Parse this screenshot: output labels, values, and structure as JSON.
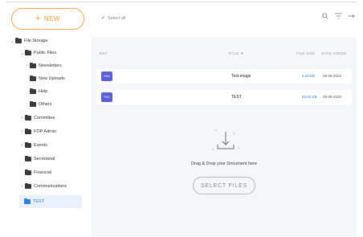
{
  "new_button": {
    "label": "NEW",
    "plus": "+"
  },
  "toolbar": {
    "select_all": "Select all",
    "icons": [
      "search-icon",
      "filter-icon",
      "expand-icon"
    ]
  },
  "sidebar": {
    "items": [
      {
        "label": "File Storage",
        "caret": "⌄"
      },
      {
        "label": "Public Files",
        "caret": "⌄"
      },
      {
        "label": "Newsletters",
        "caret": "›"
      },
      {
        "label": "New Uploads",
        "caret": ""
      },
      {
        "label": "Help",
        "caret": ""
      },
      {
        "label": "Others",
        "caret": ""
      },
      {
        "label": "Committee",
        "caret": "›"
      },
      {
        "label": "FOP Admin",
        "caret": "›"
      },
      {
        "label": "Events",
        "caret": "›"
      },
      {
        "label": "Secretarial",
        "caret": ""
      },
      {
        "label": "Financial",
        "caret": ""
      },
      {
        "label": "Communications",
        "caret": "›"
      },
      {
        "label": "TEST",
        "caret": "",
        "active": true
      }
    ]
  },
  "table": {
    "columns": {
      "ext": "EXT",
      "title": "TITLE ▼",
      "size": "FILE SIZE",
      "date": "DATE ADDED"
    },
    "rows": [
      {
        "ext": "PNG",
        "title": "Test-image",
        "size": "6.28 KB",
        "date": "29-09-2020"
      },
      {
        "ext": "PNG",
        "title": "TEST",
        "size": "82.64 KB",
        "date": "29-09-2020"
      }
    ]
  },
  "drop": {
    "text": "Drag & Drop your Document here",
    "button": "SELECT FILES"
  },
  "colors": {
    "accent": "#f19a34",
    "link": "#2a7de1",
    "badge": "#5a5fd6"
  }
}
